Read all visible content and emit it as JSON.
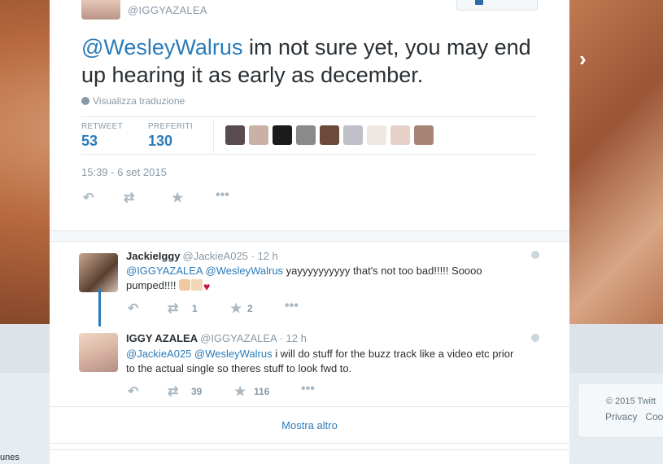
{
  "background": {
    "footer_copyright": "© 2015 Twitt",
    "footer_links": [
      "Privacy",
      "Coo"
    ],
    "left_edge_text": "unes"
  },
  "tweet": {
    "screen_name": "@IGGYAZALEA",
    "mention": "@WesleyWalrus",
    "text": " im not sure yet, you may end up hearing it as early as december.",
    "translate_label": "Visualizza traduzione",
    "retweet_label": "RETWEET",
    "retweet_count": "53",
    "favorites_label": "PREFERITI",
    "favorites_count": "130",
    "timestamp": "15:39 - 6 set 2015"
  },
  "favoriters": [
    {
      "icon": "avatar",
      "color": "#5a4a52"
    },
    {
      "icon": "avatar",
      "color": "#c9b1a6"
    },
    {
      "icon": "avatar",
      "color": "#1b1b1b"
    },
    {
      "icon": "avatar",
      "color": "#8a8a8a"
    },
    {
      "icon": "avatar",
      "color": "#6b4a3a"
    },
    {
      "icon": "avatar",
      "color": "#bfbfc9"
    },
    {
      "icon": "avatar",
      "color": "#ede8e4"
    },
    {
      "icon": "avatar",
      "color": "#e6d1c8"
    },
    {
      "icon": "avatar",
      "color": "#a78576"
    }
  ],
  "replies": [
    {
      "name": "Jackie⁣Iggy",
      "handle": "@JackieA025",
      "time": " · 12 h",
      "mention_1": "@IGGYAZALEA",
      "mention_2": "@WesleyWalrus",
      "text": " yayyyyyyyyyy that's not too bad!!!!! Soooo pumped!!!! ",
      "retweet_count": "1",
      "favorite_count": "2"
    },
    {
      "name": "IGGY AZALEA",
      "handle": "@IGGYAZALEA",
      "time": " · 12 h",
      "mention_1": "@JackieA025",
      "mention_2": "@WesleyWalrus",
      "text": " i will do stuff for the buzz track like a video etc prior to the actual single so theres stuff to look fwd to.",
      "retweet_count": "39",
      "favorite_count": "116"
    }
  ],
  "show_more_label": "Mostra altro",
  "icons": {
    "reply": "reply-icon",
    "retweet": "retweet-icon",
    "favorite": "star-icon",
    "more": "more-icon",
    "globe": "globe-icon",
    "next": "chevron-right-icon"
  },
  "colors": {
    "link": "#2b7bb9",
    "muted": "#8899a6"
  }
}
